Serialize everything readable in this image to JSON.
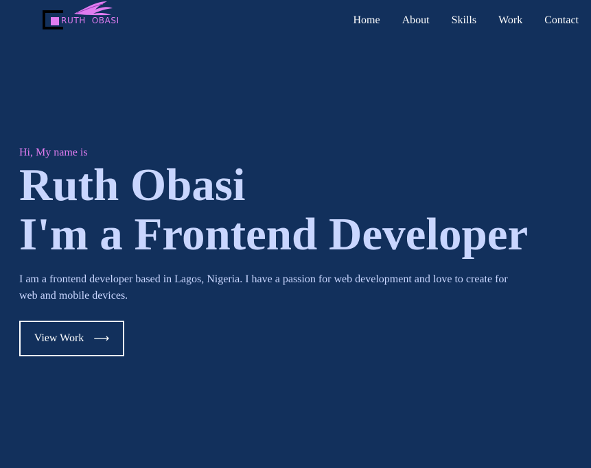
{
  "header": {
    "logo": {
      "text": "RUTH  OBASI",
      "accent_color": "#e07cf0",
      "bracket_color": "#000000"
    },
    "nav": [
      {
        "label": "Home"
      },
      {
        "label": "About"
      },
      {
        "label": "Skills"
      },
      {
        "label": "Work"
      },
      {
        "label": "Contact"
      }
    ]
  },
  "hero": {
    "intro": "Hi, My name is",
    "name": "Ruth Obasi",
    "role": "I'm a Frontend Developer",
    "description": "I am a frontend developer based in Lagos, Nigeria. I have a passion for web development and love to create for web and mobile devices.",
    "cta": {
      "label": "View Work",
      "icon": "arrow-right-icon"
    }
  },
  "colors": {
    "background": "#12305c",
    "heading": "#c9d6ff",
    "accent": "#e07cf0",
    "text": "#ffffff"
  }
}
